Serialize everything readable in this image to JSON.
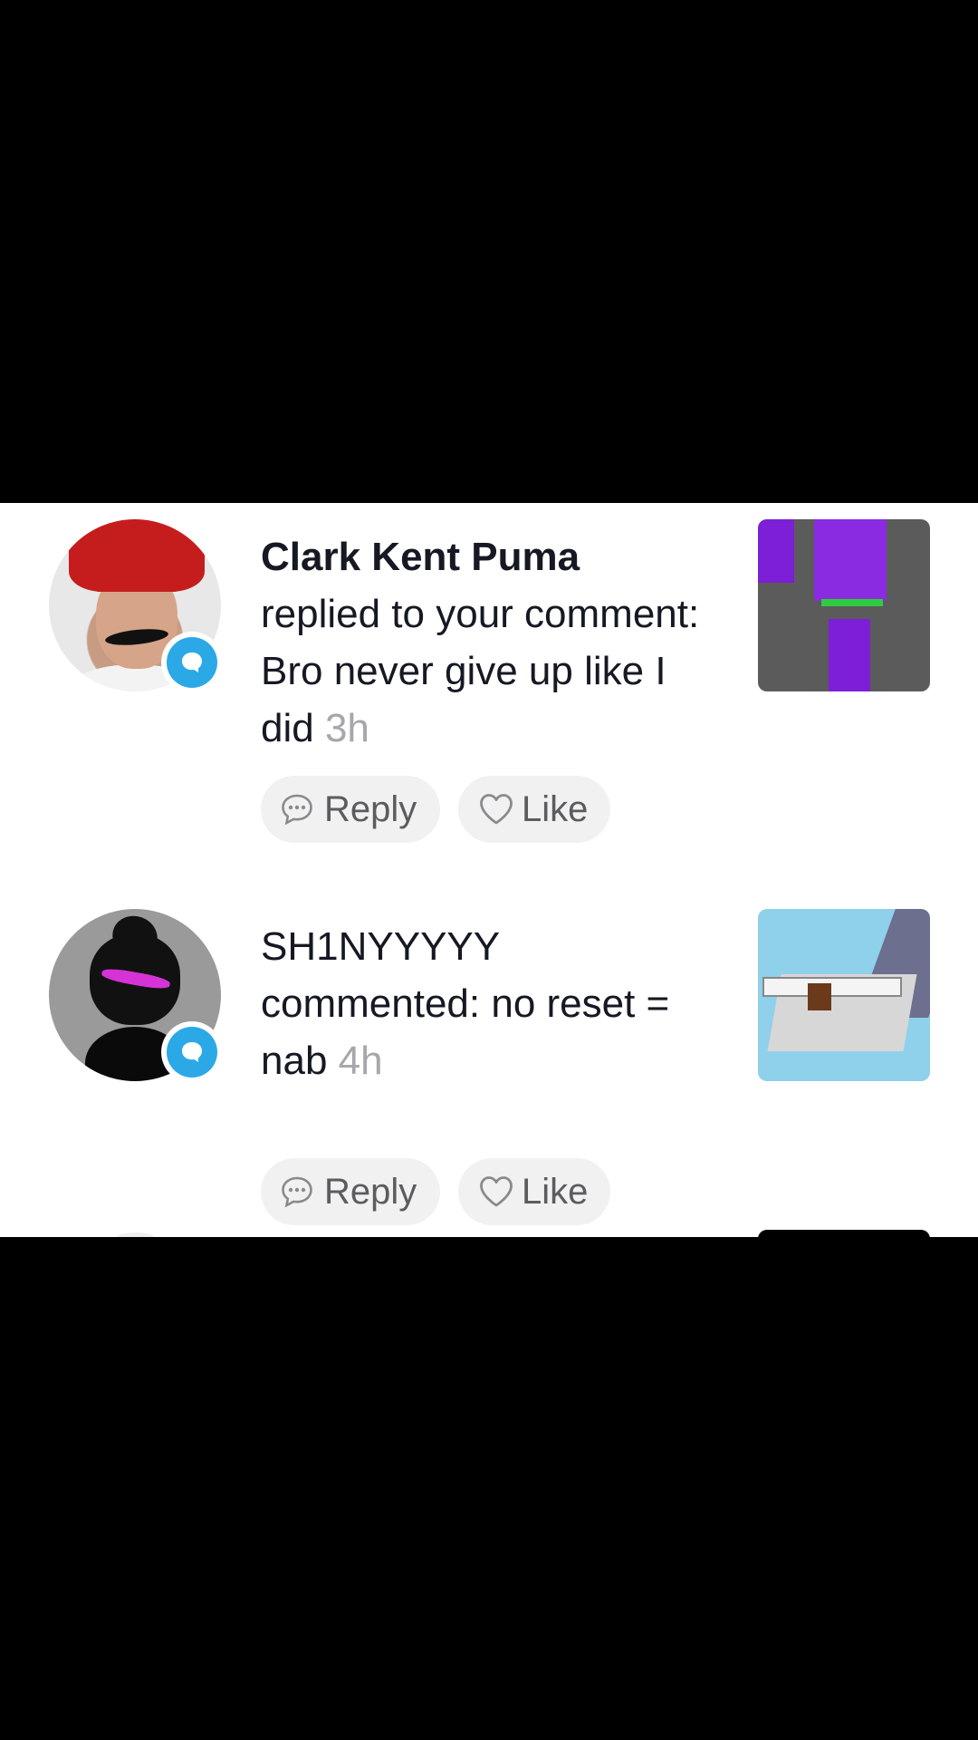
{
  "notifications": [
    {
      "username": "Clark Kent Puma",
      "action": "replied to your comment:",
      "message": "Bro never give up like I did",
      "time": "3h",
      "reply_label": "Reply",
      "like_label": "Like"
    },
    {
      "username": "SH1NYYYYY",
      "action": "commented:",
      "message": "no reset = nab",
      "time": "4h",
      "reply_label": "Reply",
      "like_label": "Like"
    }
  ],
  "colors": {
    "badge": "#2aa9e6",
    "timestamp": "#a7a7ab",
    "pill_background": "#f1f1f2"
  },
  "icons": {
    "badge": "comment-bubble-icon",
    "reply": "speech-bubble-icon",
    "like": "heart-icon"
  }
}
